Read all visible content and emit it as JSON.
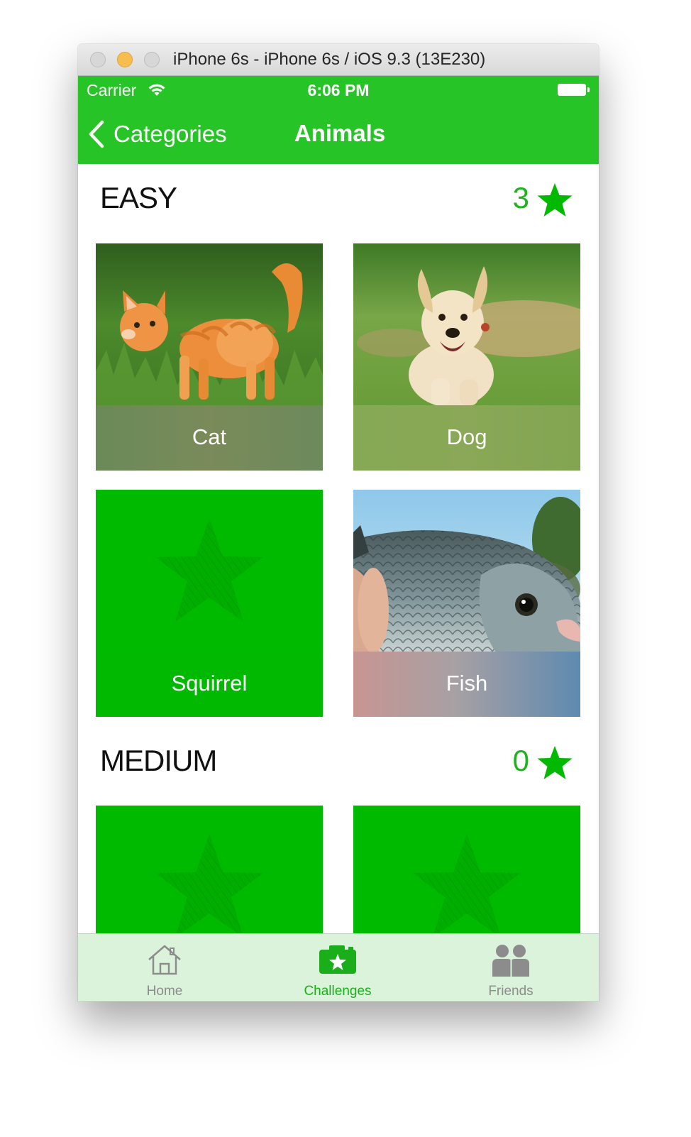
{
  "window": {
    "title": "iPhone 6s - iPhone 6s / iOS 9.3 (13E230)"
  },
  "status_bar": {
    "carrier": "Carrier",
    "time": "6:06 PM"
  },
  "nav": {
    "back_label": "Categories",
    "title": "Animals"
  },
  "sections": [
    {
      "title": "EASY",
      "count": "3",
      "items": [
        {
          "label": "Cat",
          "state": "unlocked",
          "image": "cat-photo"
        },
        {
          "label": "Dog",
          "state": "unlocked",
          "image": "dog-photo"
        },
        {
          "label": "Squirrel",
          "state": "locked",
          "image": "star-placeholder"
        },
        {
          "label": "Fish",
          "state": "unlocked",
          "image": "fish-photo"
        }
      ]
    },
    {
      "title": "MEDIUM",
      "count": "0",
      "items": [
        {
          "label": "",
          "state": "locked",
          "image": "star-placeholder"
        },
        {
          "label": "",
          "state": "locked",
          "image": "star-placeholder"
        }
      ]
    }
  ],
  "tabbar": {
    "tabs": [
      {
        "label": "Home",
        "icon": "home-icon",
        "active": false
      },
      {
        "label": "Challenges",
        "icon": "camera-star-icon",
        "active": true
      },
      {
        "label": "Friends",
        "icon": "people-icon",
        "active": false
      }
    ]
  },
  "colors": {
    "accent": "#27c427",
    "tile_locked": "#00ba00",
    "tabbar_bg": "#dcf3db",
    "tab_active": "#1aaf1a",
    "tab_inactive": "#8c8c8c"
  }
}
